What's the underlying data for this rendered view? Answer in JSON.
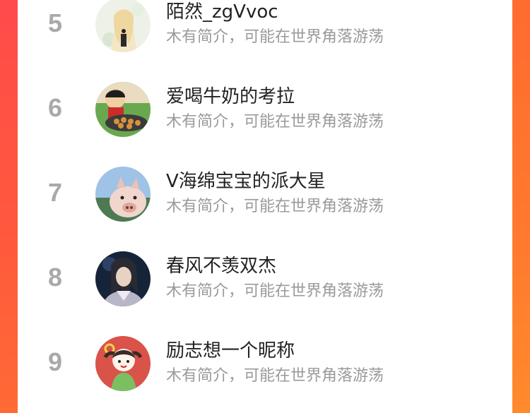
{
  "colors": {
    "accent_left": "#ff4b4b",
    "accent_right": "#ff7a2e",
    "rank_color": "#a9a9a9",
    "name_color": "#222222",
    "bio_color": "#9a9a9a"
  },
  "list": {
    "items": [
      {
        "rank": "5",
        "name": "陌然_zgVvoc",
        "bio": "木有简介，可能在世界角落游荡"
      },
      {
        "rank": "6",
        "name": "爱喝牛奶的考拉",
        "bio": "木有简介，可能在世界角落游荡"
      },
      {
        "rank": "7",
        "name": "V海绵宝宝的派大星",
        "bio": "木有简介，可能在世界角落游荡"
      },
      {
        "rank": "8",
        "name": "春风不羡双杰",
        "bio": "木有简介，可能在世界角落游荡"
      },
      {
        "rank": "9",
        "name": "励志想一个昵称",
        "bio": "木有简介，可能在世界角落游荡"
      }
    ]
  }
}
